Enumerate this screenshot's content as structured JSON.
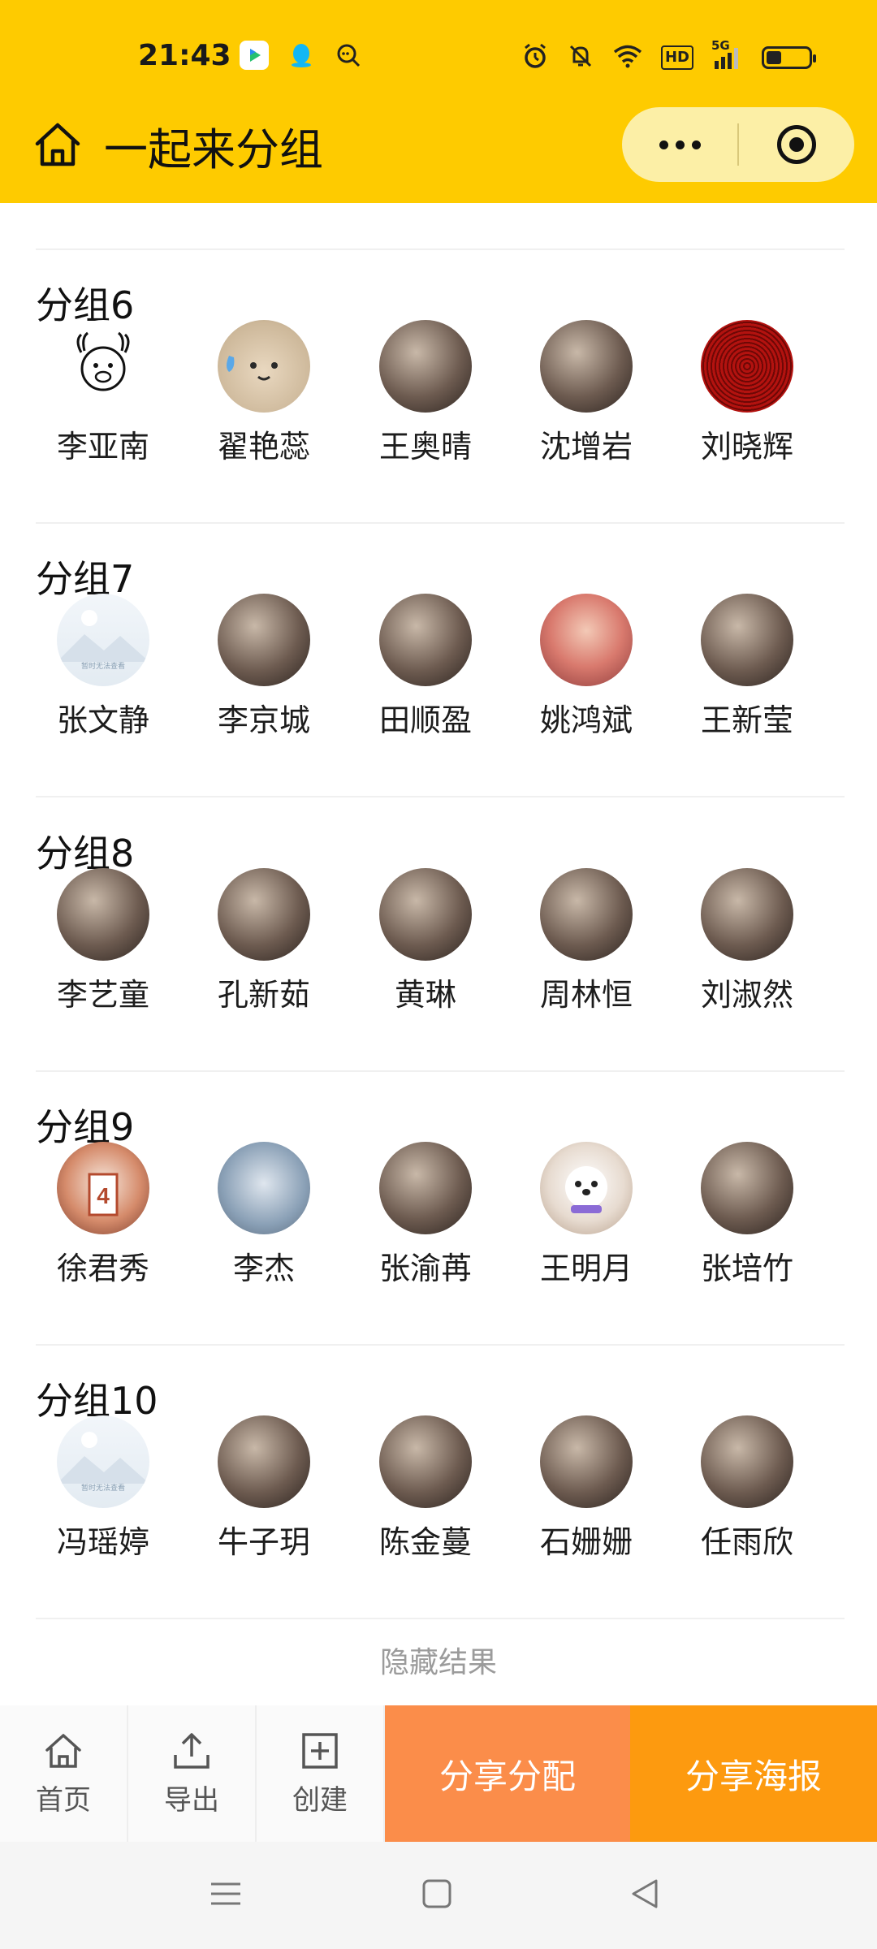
{
  "status_bar": {
    "time": "21:43",
    "network": "5G",
    "hd": "HD"
  },
  "header": {
    "title": "一起来分组"
  },
  "groups": [
    {
      "title": "分组6",
      "members": [
        {
          "name": "李亚南",
          "avatar": "cartoon-sketch"
        },
        {
          "name": "翟艳蕊",
          "avatar": "cartoon-cat"
        },
        {
          "name": "王奥晴",
          "avatar": "photo"
        },
        {
          "name": "沈增岩",
          "avatar": "photo"
        },
        {
          "name": "刘晓辉",
          "avatar": "red-pattern"
        }
      ]
    },
    {
      "title": "分组7",
      "members": [
        {
          "name": "张文静",
          "avatar": "placeholder",
          "placeholder_text": "暂时无法查看"
        },
        {
          "name": "李京城",
          "avatar": "photo"
        },
        {
          "name": "田顺盈",
          "avatar": "photo"
        },
        {
          "name": "姚鸿斌",
          "avatar": "anime"
        },
        {
          "name": "王新莹",
          "avatar": "photo"
        }
      ]
    },
    {
      "title": "分组8",
      "members": [
        {
          "name": "李艺童",
          "avatar": "photo"
        },
        {
          "name": "孔新茹",
          "avatar": "photo"
        },
        {
          "name": "黄琳",
          "avatar": "photo"
        },
        {
          "name": "周林恒",
          "avatar": "photo"
        },
        {
          "name": "刘淑然",
          "avatar": "photo"
        }
      ]
    },
    {
      "title": "分组9",
      "members": [
        {
          "name": "徐君秀",
          "avatar": "basketball"
        },
        {
          "name": "李杰",
          "avatar": "cartoon"
        },
        {
          "name": "张渝苒",
          "avatar": "photo"
        },
        {
          "name": "王明月",
          "avatar": "dog"
        },
        {
          "name": "张培竹",
          "avatar": "photo"
        }
      ]
    },
    {
      "title": "分组10",
      "members": [
        {
          "name": "冯瑶婷",
          "avatar": "placeholder",
          "placeholder_text": "暂时无法查看"
        },
        {
          "name": "牛子玥",
          "avatar": "photo"
        },
        {
          "name": "陈金蔓",
          "avatar": "photo"
        },
        {
          "name": "石姗姗",
          "avatar": "photo"
        },
        {
          "name": "任雨欣",
          "avatar": "photo"
        }
      ]
    }
  ],
  "hide_result_label": "隐藏结果",
  "toolbar": {
    "home_label": "首页",
    "export_label": "导出",
    "create_label": "创建",
    "share_assign_label": "分享分配",
    "share_poster_label": "分享海报"
  },
  "colors": {
    "header_bg": "#fecb00",
    "share_assign_bg": "#fb8d4a",
    "share_poster_bg": "#fd9a0f"
  }
}
